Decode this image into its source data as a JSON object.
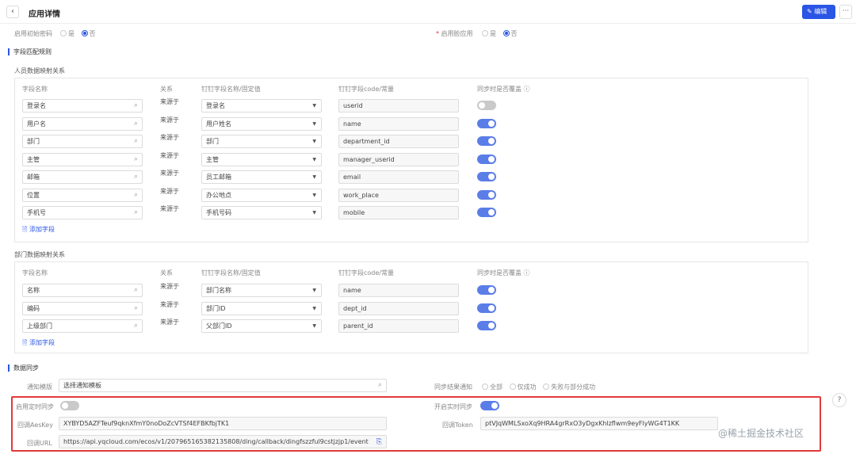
{
  "header": {
    "back_icon": "‹",
    "title": "应用详情",
    "edit_label": "编辑",
    "more_label": "···"
  },
  "top": {
    "init_password_label": "启用初始密码",
    "init_password_options": [
      "是",
      "否"
    ],
    "face_app_label": "启用脸应用",
    "face_app_options": [
      "是",
      "否"
    ]
  },
  "field_rules": {
    "section_title": "字段匹配规则",
    "person_title": "人员数据映射关系",
    "columns": {
      "field_name": "字段名称",
      "relation": "关系",
      "dd_field": "钉钉字段名称/固定值",
      "dd_code": "钉钉字段code/常量",
      "override": "同步时是否覆盖"
    },
    "person_rows": [
      {
        "field": "登录名",
        "relation": "来源于",
        "dd_field": "登录名",
        "code": "userid",
        "override": false
      },
      {
        "field": "用户名",
        "relation": "来源于",
        "dd_field": "用户姓名",
        "code": "name",
        "override": true
      },
      {
        "field": "部门",
        "relation": "来源于",
        "dd_field": "部门",
        "code": "department_id",
        "override": true
      },
      {
        "field": "主管",
        "relation": "来源于",
        "dd_field": "主管",
        "code": "manager_userid",
        "override": true
      },
      {
        "field": "邮箱",
        "relation": "来源于",
        "dd_field": "员工邮箱",
        "code": "email",
        "override": true
      },
      {
        "field": "位置",
        "relation": "来源于",
        "dd_field": "办公地点",
        "code": "work_place",
        "override": true
      },
      {
        "field": "手机号",
        "relation": "来源于",
        "dd_field": "手机号码",
        "code": "mobile",
        "override": true
      }
    ],
    "add_field_label": "添加字段",
    "dept_title": "部门数据映射关系",
    "dept_rows": [
      {
        "field": "名称",
        "relation": "来源于",
        "dd_field": "部门名称",
        "code": "name",
        "override": true
      },
      {
        "field": "编码",
        "relation": "来源于",
        "dd_field": "部门ID",
        "code": "dept_id",
        "override": true
      },
      {
        "field": "上级部门",
        "relation": "来源于",
        "dd_field": "父部门ID",
        "code": "parent_id",
        "override": true
      }
    ]
  },
  "data_sync": {
    "section_title": "数据同步",
    "notify_template_label": "通知模版",
    "notify_template_value": "选择通知模板",
    "sync_result_label": "同步结果通知",
    "sync_result_options": [
      "全部",
      "仅成功",
      "失败与部分成功"
    ],
    "scheduled_sync_label": "启用定时同步",
    "realtime_sync_label": "开启实时同步",
    "aes_key_label": "回调AesKey",
    "aes_key_value": "XYBYD5AZFTeuf9qknXfmY0noDoZcVTSf4EFBKfbjTK1",
    "token_label": "回调Token",
    "token_value": "ptVJqWMLSxoXq9HRA4grRxO3yDgxKhlzflwm9eyFlyWG4T1KK",
    "url_label": "回调URL",
    "url_value": "https://api.yqcloud.com/ecos/v1/207965165382135808/ding/callback/dingfszzful9cstjzjp1/event"
  },
  "footer_watermark": "@稀土掘金技术社区",
  "colors": {
    "accent": "#2a55e5",
    "toggle_on": "#5b7de8",
    "toggle_off": "#c9c9c9",
    "highlight": "#e03a3a"
  }
}
